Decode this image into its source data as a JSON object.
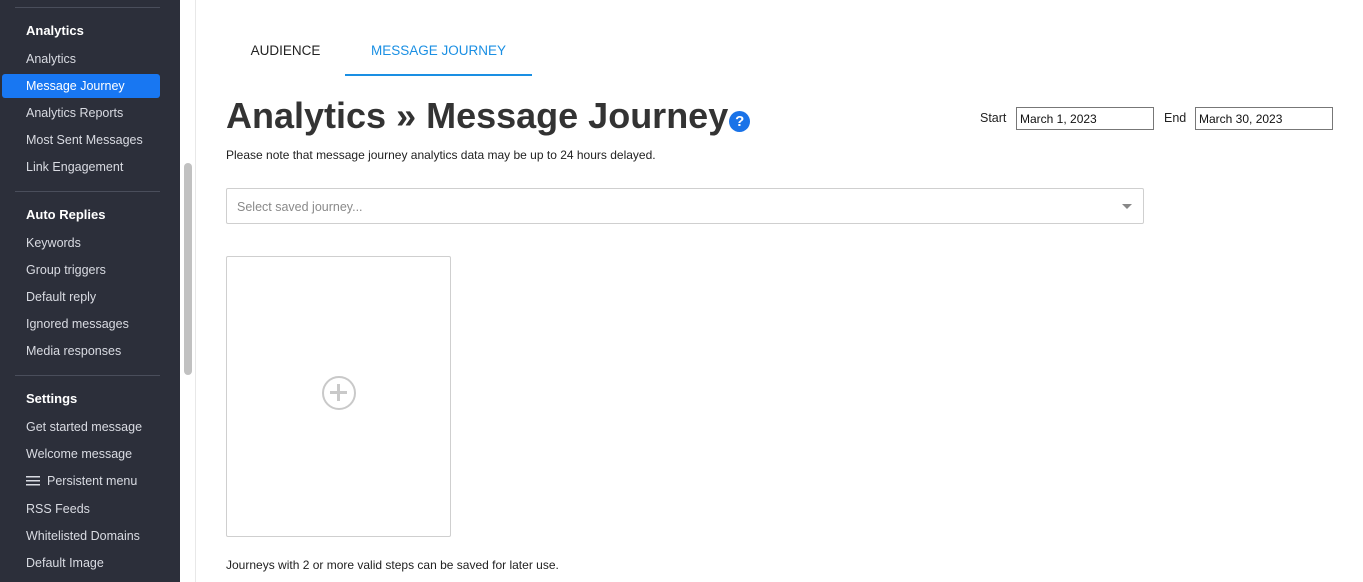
{
  "sidebar": {
    "sections": [
      {
        "title": "Analytics",
        "items": [
          "Analytics",
          "Message Journey",
          "Analytics Reports",
          "Most Sent Messages",
          "Link Engagement"
        ]
      },
      {
        "title": "Auto Replies",
        "items": [
          "Keywords",
          "Group triggers",
          "Default reply",
          "Ignored messages",
          "Media responses"
        ]
      },
      {
        "title": "Settings",
        "items": [
          "Get started message",
          "Welcome message",
          "Persistent menu",
          "RSS Feeds",
          "Whitelisted Domains",
          "Default Image"
        ]
      }
    ],
    "active_item": "Message Journey"
  },
  "tabs": [
    {
      "label": "AUDIENCE",
      "active": false
    },
    {
      "label": "MESSAGE JOURNEY",
      "active": true
    }
  ],
  "page": {
    "title": "Analytics » Message Journey",
    "help_icon": "?",
    "note": "Please note that message journey analytics data may be up to 24 hours delayed.",
    "start_label": "Start",
    "start_value": "March 1, 2023",
    "end_label": "End",
    "end_value": "March 30, 2023",
    "select_placeholder": "Select saved journey...",
    "footer_note": "Journeys with 2 or more valid steps can be saved for later use."
  },
  "colors": {
    "sidebar_bg": "#2c2f3a",
    "active_item_bg": "#1877f2",
    "accent": "#1a8fe3"
  }
}
